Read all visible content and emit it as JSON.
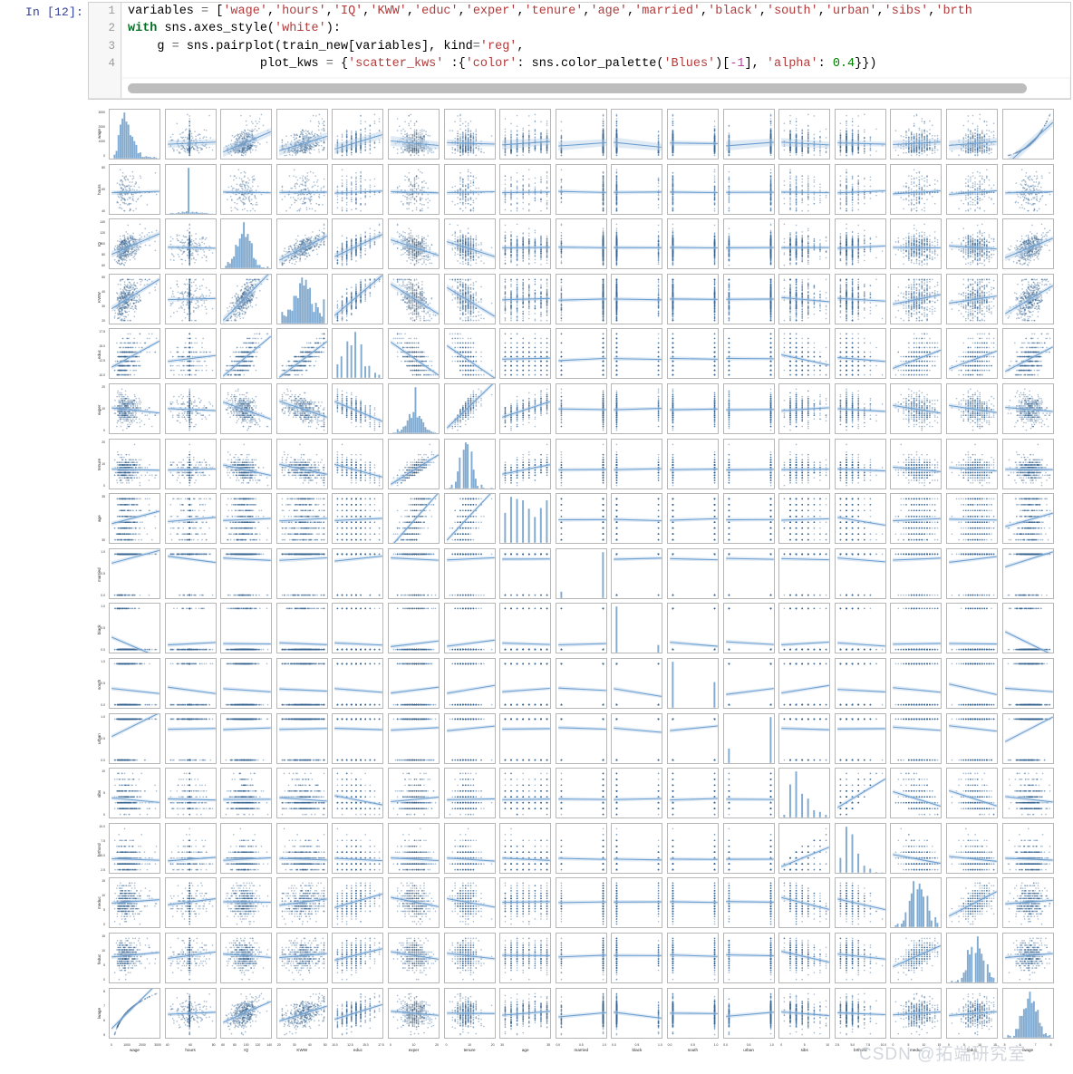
{
  "notebook": {
    "prompt": "In [12]:",
    "line_numbers": [
      "1",
      "2",
      "3",
      "4"
    ],
    "code_lines": [
      "variables = ['wage','hours','IQ','KWW','educ','exper','tenure','age','married','black','south','urban','sibs','brth",
      "with sns.axes_style('white'):",
      "    g = sns.pairplot(train_new[variables], kind='reg',",
      "                  plot_kws = {'scatter_kws' :{'color': sns.color_palette('Blues')[-1], 'alpha': 0.4}})"
    ],
    "scrollbar": "horizontal-scrollbar"
  },
  "watermark": {
    "text": "CSDN @拓端研究室"
  },
  "colors": {
    "point": "#35618f",
    "line": "#6c9fd0",
    "band": "#b8d0e8",
    "hist": "#7ba7cf",
    "panel_border": "#b6b6b6",
    "prompt": "#303f9f",
    "string": "#b33a3a",
    "keyword": "#007020",
    "number": "#008000"
  },
  "chart_data": {
    "type": "scatter",
    "plot_kind": "pairplot-matrix",
    "title": "",
    "diagonal": "histogram",
    "offdiagonal": "scatter with linear regression fit and confidence band",
    "n_variables": 17,
    "variables": [
      "wage",
      "hours",
      "IQ",
      "KWW",
      "educ",
      "exper",
      "tenure",
      "age",
      "married",
      "black",
      "south",
      "urban",
      "sibs",
      "brthord",
      "meduc",
      "feduc",
      "lwage"
    ],
    "xlabels": [
      "wage",
      "hours",
      "IQ",
      "KWW",
      "educ",
      "exper",
      "tenure",
      "age",
      "married",
      "black",
      "south",
      "urban",
      "sibs",
      "brthord",
      "meduc",
      "feduc",
      "lwage"
    ],
    "ylabels": [
      "wage",
      "hours",
      "IQ",
      "KWW",
      "educ",
      "exper",
      "tenure",
      "age",
      "married",
      "black",
      "south",
      "urban",
      "sibs",
      "brthord",
      "meduc",
      "feduc",
      "lwage"
    ],
    "axis_ranges": {
      "wage": [
        0,
        3500
      ],
      "hours": [
        20,
        85
      ],
      "IQ": [
        45,
        150
      ],
      "KWW": [
        10,
        58
      ],
      "educ": [
        8,
        19
      ],
      "exper": [
        0,
        24
      ],
      "tenure": [
        0,
        23
      ],
      "age": [
        27,
        35
      ],
      "married": [
        0.0,
        1.0
      ],
      "black": [
        0.0,
        1.0
      ],
      "south": [
        0.0,
        1.0
      ],
      "urban": [
        0.0,
        1.0
      ],
      "sibs": [
        0,
        16
      ],
      "brthord": [
        1,
        11
      ],
      "meduc": [
        0,
        18
      ],
      "feduc": [
        0,
        18
      ],
      "lwage": [
        5.0,
        8.2
      ]
    },
    "ticks": {
      "wage": [
        "0",
        "1000",
        "2000",
        "3000"
      ],
      "hours": [
        "40",
        "60",
        "80"
      ],
      "IQ": [
        "60",
        "80",
        "100",
        "120",
        "140"
      ],
      "KWW": [
        "20",
        "30",
        "40",
        "50"
      ],
      "educ": [
        "10.0",
        "12.5",
        "15.0",
        "17.5"
      ],
      "exper": [
        "0",
        "10",
        "20"
      ],
      "tenure": [
        "0",
        "10",
        "20"
      ],
      "age": [
        "30",
        "35"
      ],
      "married": [
        "0.0",
        "0.5",
        "1.0"
      ],
      "black": [
        "0.0",
        "0.5",
        "1.0"
      ],
      "south": [
        "0.0",
        "0.5",
        "1.0"
      ],
      "urban": [
        "0.0",
        "0.5",
        "1.0"
      ],
      "sibs": [
        "0",
        "5",
        "10"
      ],
      "brthord": [
        "2.5",
        "5.0",
        "7.5",
        "10.0"
      ],
      "meduc": [
        "0",
        "5",
        "10",
        "15"
      ],
      "feduc": [
        "0",
        "5",
        "10",
        "15"
      ],
      "lwage": [
        "5",
        "6",
        "7",
        "8"
      ]
    },
    "binary_variables": [
      "married",
      "black",
      "south",
      "urban"
    ],
    "notable_relationships": [
      {
        "x": "wage",
        "y": "lwage",
        "shape": "logarithmic, near-deterministic"
      },
      {
        "x": "IQ",
        "y": "KWW",
        "slope": "positive"
      },
      {
        "x": "educ",
        "y": "wage",
        "slope": "positive"
      },
      {
        "x": "exper",
        "y": "tenure",
        "slope": "positive"
      },
      {
        "x": "meduc",
        "y": "feduc",
        "slope": "positive"
      },
      {
        "x": "sibs",
        "y": "brthord",
        "slope": "positive"
      },
      {
        "x": "educ",
        "y": "exper",
        "slope": "negative"
      },
      {
        "x": "black",
        "y": "IQ",
        "slope": "negative"
      }
    ]
  }
}
